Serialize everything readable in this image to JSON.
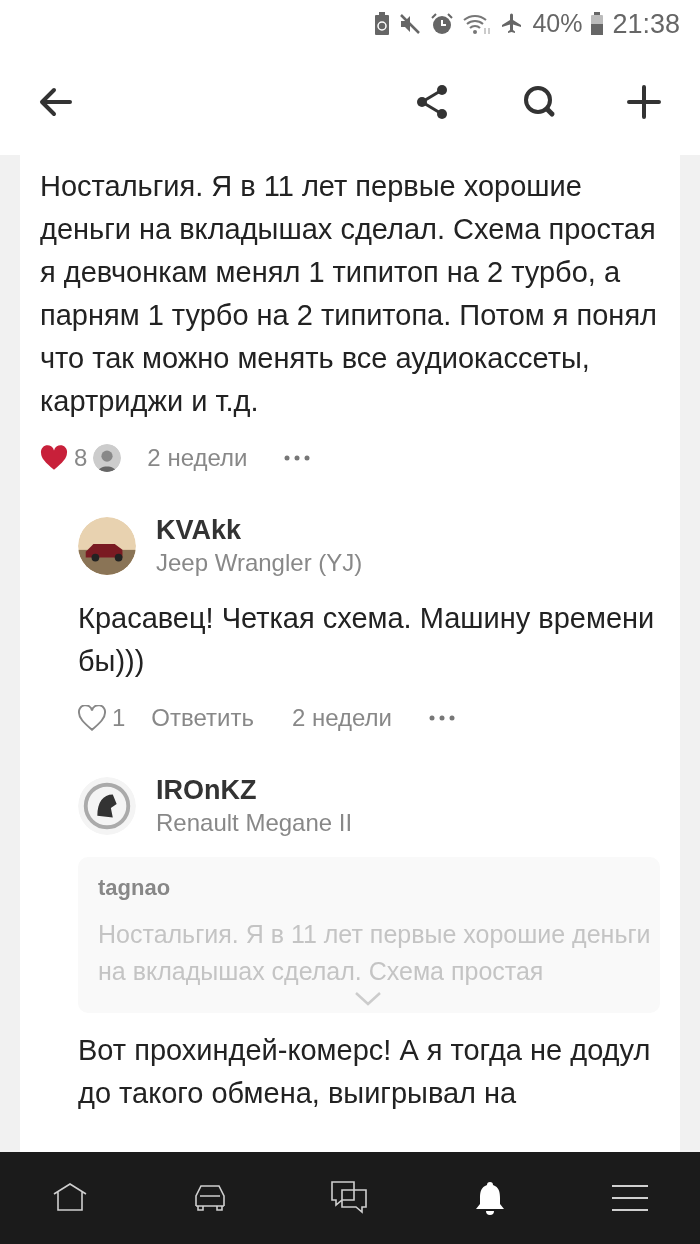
{
  "status_bar": {
    "battery": "40%",
    "time": "21:38"
  },
  "comments": [
    {
      "kind": "own",
      "text": "Ностальгия. Я в 11 лет первые хорошие деньги на вкладышах сделал. Схема простая я девчонкам менял 1 типитоп на 2 турбо, а парням 1 турбо на 2 типитопа. Потом я понял что так можно менять все аудиокассеты, картриджи и т.д.",
      "liked": true,
      "likes": "8",
      "time": "2 недели"
    },
    {
      "kind": "reply",
      "author": "KVAkk",
      "car": "Jeep Wrangler (YJ)",
      "text": "Красавец! Четкая схема. Машину времени бы)))",
      "liked": false,
      "likes": "1",
      "reply": "Ответить",
      "time": "2 недели"
    },
    {
      "kind": "quote_reply",
      "author": "IROnKZ",
      "car": "Renault Megane II",
      "quote": {
        "author": "tagnao",
        "text": "Ностальгия. Я в 11 лет первые хорошие деньги на вкладышах сделал. Схема простая"
      },
      "text": "Вот прохиндей-комерс! А я тогда не додул до такого обмена, выигрывал на"
    }
  ],
  "bottom_nav": [
    {
      "kind": "home",
      "selected": false
    },
    {
      "kind": "car",
      "selected": false
    },
    {
      "kind": "chat",
      "selected": false
    },
    {
      "kind": "bell",
      "selected": true
    },
    {
      "kind": "menu",
      "selected": false
    }
  ]
}
